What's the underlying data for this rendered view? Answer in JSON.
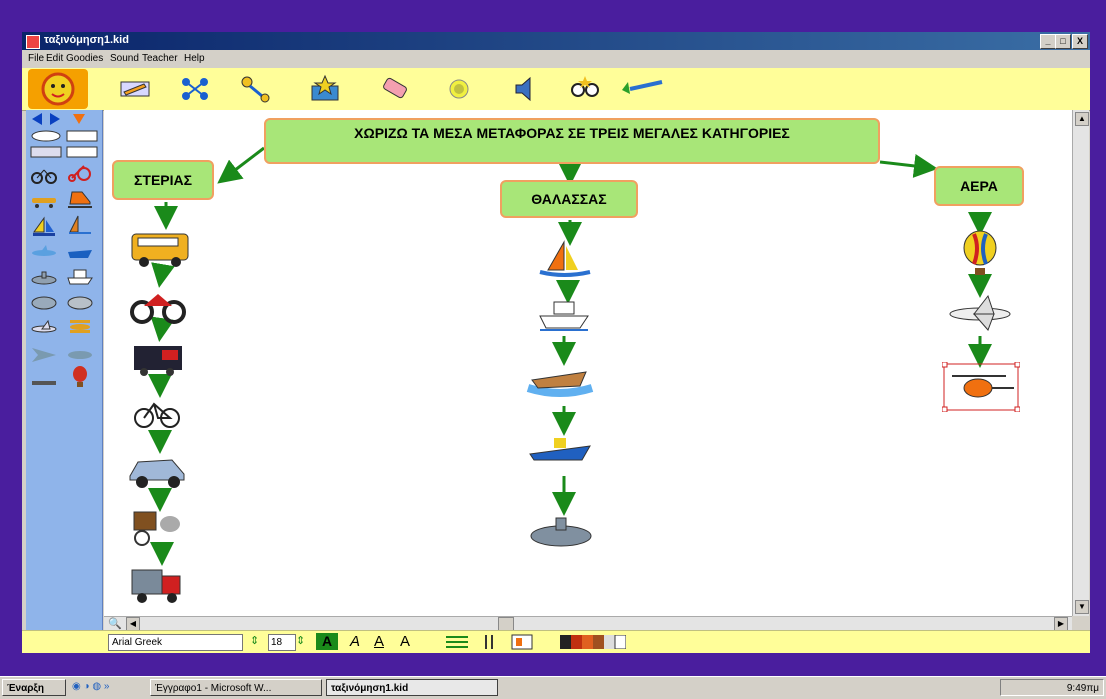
{
  "window": {
    "title": "ταξινόμηση1.kid"
  },
  "menu": [
    "File",
    "Edit",
    "Goodies",
    "Sound",
    "Teacher",
    "Help"
  ],
  "title_buttons": [
    "_",
    "□",
    "X"
  ],
  "toolbar_tools": [
    "pencil-tool-icon",
    "diagram-tool-icon",
    "link-tool-icon",
    "goodies-box-icon",
    "eraser-icon",
    "idea-bulb-icon",
    "sound-icon",
    "glasses-icon",
    "paintbrush-icon"
  ],
  "map": {
    "main_title": "ΧΩΡΙΖΩ ΤΑ ΜΕΣΑ ΜΕΤΑΦΟΡΑΣ ΣΕ ΤΡΕΙΣ ΜΕΓΑΛΕΣ ΚΑΤΗΓΟΡΙΕΣ",
    "categories": [
      {
        "label": "ΣΤΕΡΙΑΣ",
        "items": [
          "bus",
          "motorcycle",
          "train",
          "bicycle",
          "car",
          "horse-cart",
          "truck"
        ]
      },
      {
        "label": "ΘΑΛΑΣΣΑΣ",
        "items": [
          "sailboat",
          "ship",
          "rowboat",
          "speedboat",
          "submarine"
        ]
      },
      {
        "label": "ΑΕΡΑ",
        "items": [
          "hot-air-balloon",
          "airplane",
          "helicopter"
        ]
      }
    ]
  },
  "format_bar": {
    "font_name": "Arial Greek",
    "font_size": "18",
    "text_styles": [
      "A",
      "A",
      "A",
      "A"
    ]
  },
  "taskbar": {
    "start_label": "Έναρξη",
    "tasks": [
      "Έγγραφο1 - Microsoft W...",
      "ταξινόμηση1.kid"
    ],
    "clock": "9:49πμ"
  },
  "colors": {
    "node_fill": "#a8e678",
    "node_border": "#f0a060",
    "arrow": "#1a8a1a",
    "toolbar": "#fffe99",
    "palette": "#8fb4ea",
    "desktop": "#4a1e9e"
  }
}
